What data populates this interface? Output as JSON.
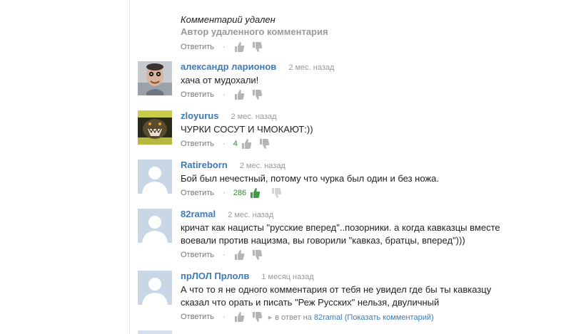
{
  "deleted_comment": {
    "title": "Комментарий удален",
    "subtitle": "Автор удаленного комментария",
    "reply_label": "Ответить",
    "separator": "·"
  },
  "comments": [
    {
      "author": "александр ларионов",
      "time": "2 мес. назад",
      "text": "хача от мудохали!",
      "reply_label": "Ответить",
      "likes": "",
      "avatar_type": "photo-man"
    },
    {
      "author": "zloyurus",
      "time": "2 мес. назад",
      "text": "ЧУРКИ СОСУТ И ЧМОКАЮТ:))",
      "reply_label": "Ответить",
      "likes": "4",
      "avatar_type": "photo-beast"
    },
    {
      "author": "Ratireborn",
      "time": "2 мес. назад",
      "text": "Бой был нечестный, потому что чурка был один и без ножа.",
      "reply_label": "Ответить",
      "likes": "286",
      "avatar_type": "default"
    },
    {
      "author": "82ramal",
      "time": "2 мес. назад",
      "text": "кричат как нацисты \"русские вперед\"..позорники. а когда кавказцы вместе воевали против нацизма, вы говорили \"кавказ, братцы, вперед\")))",
      "reply_label": "Ответить",
      "likes": "",
      "avatar_type": "default"
    },
    {
      "author": "прЛОЛ Прлолв",
      "time": "1 месяц назад",
      "text": "А что то я не одного комментария от тебя не увидел где бы ты кавказцу сказал что орать и писать \"Реж Русских\" нельзя, двуличный",
      "reply_label": "Ответить",
      "likes": "",
      "avatar_type": "default",
      "in_reply_prefix": "в ответ на",
      "in_reply_user": "82ramal",
      "in_reply_link": "(Показать комментарий)"
    }
  ],
  "colors": {
    "author_link": "#3d7ab8",
    "likes_green": "#2a8f2a",
    "default_avatar_bg": "#c9d6e6",
    "default_avatar_fg": "#ffffff"
  }
}
